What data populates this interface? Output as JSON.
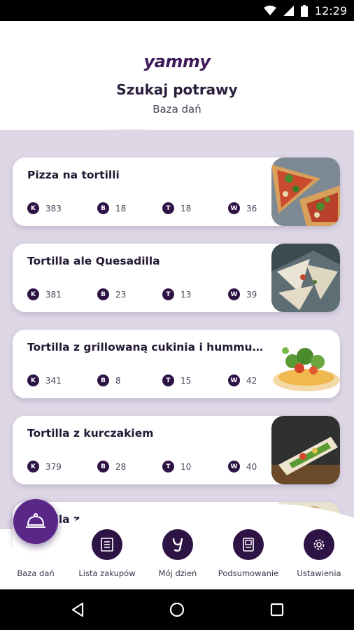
{
  "status_bar": {
    "time": "12:29"
  },
  "header": {
    "logo": "yammy",
    "title": "Szukaj potrawy",
    "subtitle": "Baza dań"
  },
  "recipes": [
    {
      "name": "Pizza na tortilli",
      "k": "383",
      "b": "18",
      "t": "18",
      "w": "36"
    },
    {
      "name": "Tortilla ale Quesadilla",
      "k": "381",
      "b": "23",
      "t": "13",
      "w": "39"
    },
    {
      "name": "Tortilla z grillowaną cukinia i hummus...",
      "k": "341",
      "b": "8",
      "t": "15",
      "w": "42"
    },
    {
      "name": "Tortilla z kurczakiem",
      "k": "379",
      "b": "28",
      "t": "10",
      "w": "40"
    },
    {
      "name": "Tortilla z ...",
      "k": "",
      "b": "",
      "t": "",
      "w": ""
    }
  ],
  "badge_letters": {
    "k": "K",
    "b": "B",
    "t": "T",
    "w": "W"
  },
  "bottom_nav": [
    {
      "label": "Baza dań",
      "icon": "cloche-icon",
      "active": true
    },
    {
      "label": "Lista zakupów",
      "icon": "list-icon"
    },
    {
      "label": "Mój dzień",
      "icon": "yammy-icon"
    },
    {
      "label": "Podsumowanie",
      "icon": "summary-icon"
    },
    {
      "label": "Ustawienia",
      "icon": "gear-icon"
    }
  ],
  "colors": {
    "brand_dark": "#2e1345",
    "brand_accent": "#5a2788",
    "list_background": "#ddd7e6"
  }
}
